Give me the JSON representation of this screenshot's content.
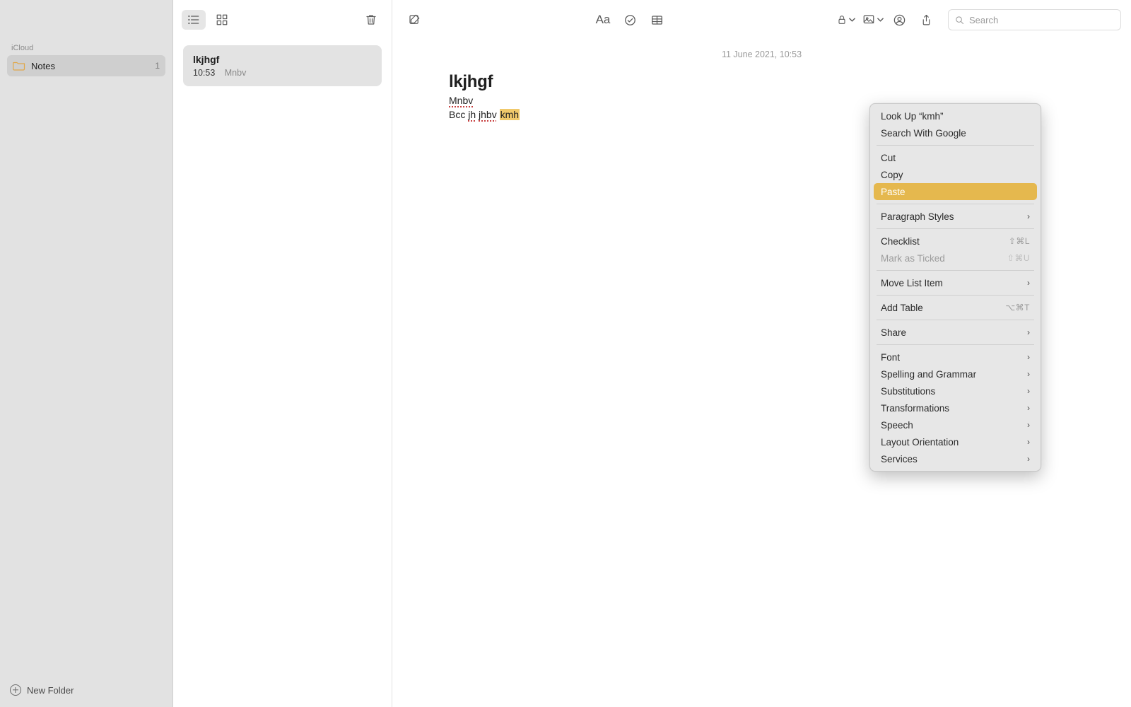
{
  "sidebar": {
    "section": "iCloud",
    "folder": {
      "name": "Notes",
      "count": "1"
    },
    "new_folder_label": "New Folder"
  },
  "list": {
    "note": {
      "title": "lkjhgf",
      "time": "10:53",
      "preview": "Mnbv"
    }
  },
  "editor": {
    "timestamp": "11 June 2021, 10:53",
    "title": "lkjhgf",
    "line1": "Mnbv",
    "line2_pre": "Bcc ",
    "line2_mis1": "jh",
    "line2_sep": " ",
    "line2_mis2": "jhbv",
    "line2_gap": " ",
    "line2_sel": "kmh"
  },
  "search": {
    "placeholder": "Search"
  },
  "ctx": {
    "lookup": "Look Up “kmh”",
    "search_google": "Search With Google",
    "cut": "Cut",
    "copy": "Copy",
    "paste": "Paste",
    "para_styles": "Paragraph Styles",
    "checklist": "Checklist",
    "checklist_sc": "⇧⌘L",
    "mark_ticked": "Mark as Ticked",
    "mark_ticked_sc": "⇧⌘U",
    "move_list": "Move List Item",
    "add_table": "Add Table",
    "add_table_sc": "⌥⌘T",
    "share": "Share",
    "font": "Font",
    "spelling": "Spelling and Grammar",
    "subs": "Substitutions",
    "transforms": "Transformations",
    "speech": "Speech",
    "layout": "Layout Orientation",
    "services": "Services"
  }
}
